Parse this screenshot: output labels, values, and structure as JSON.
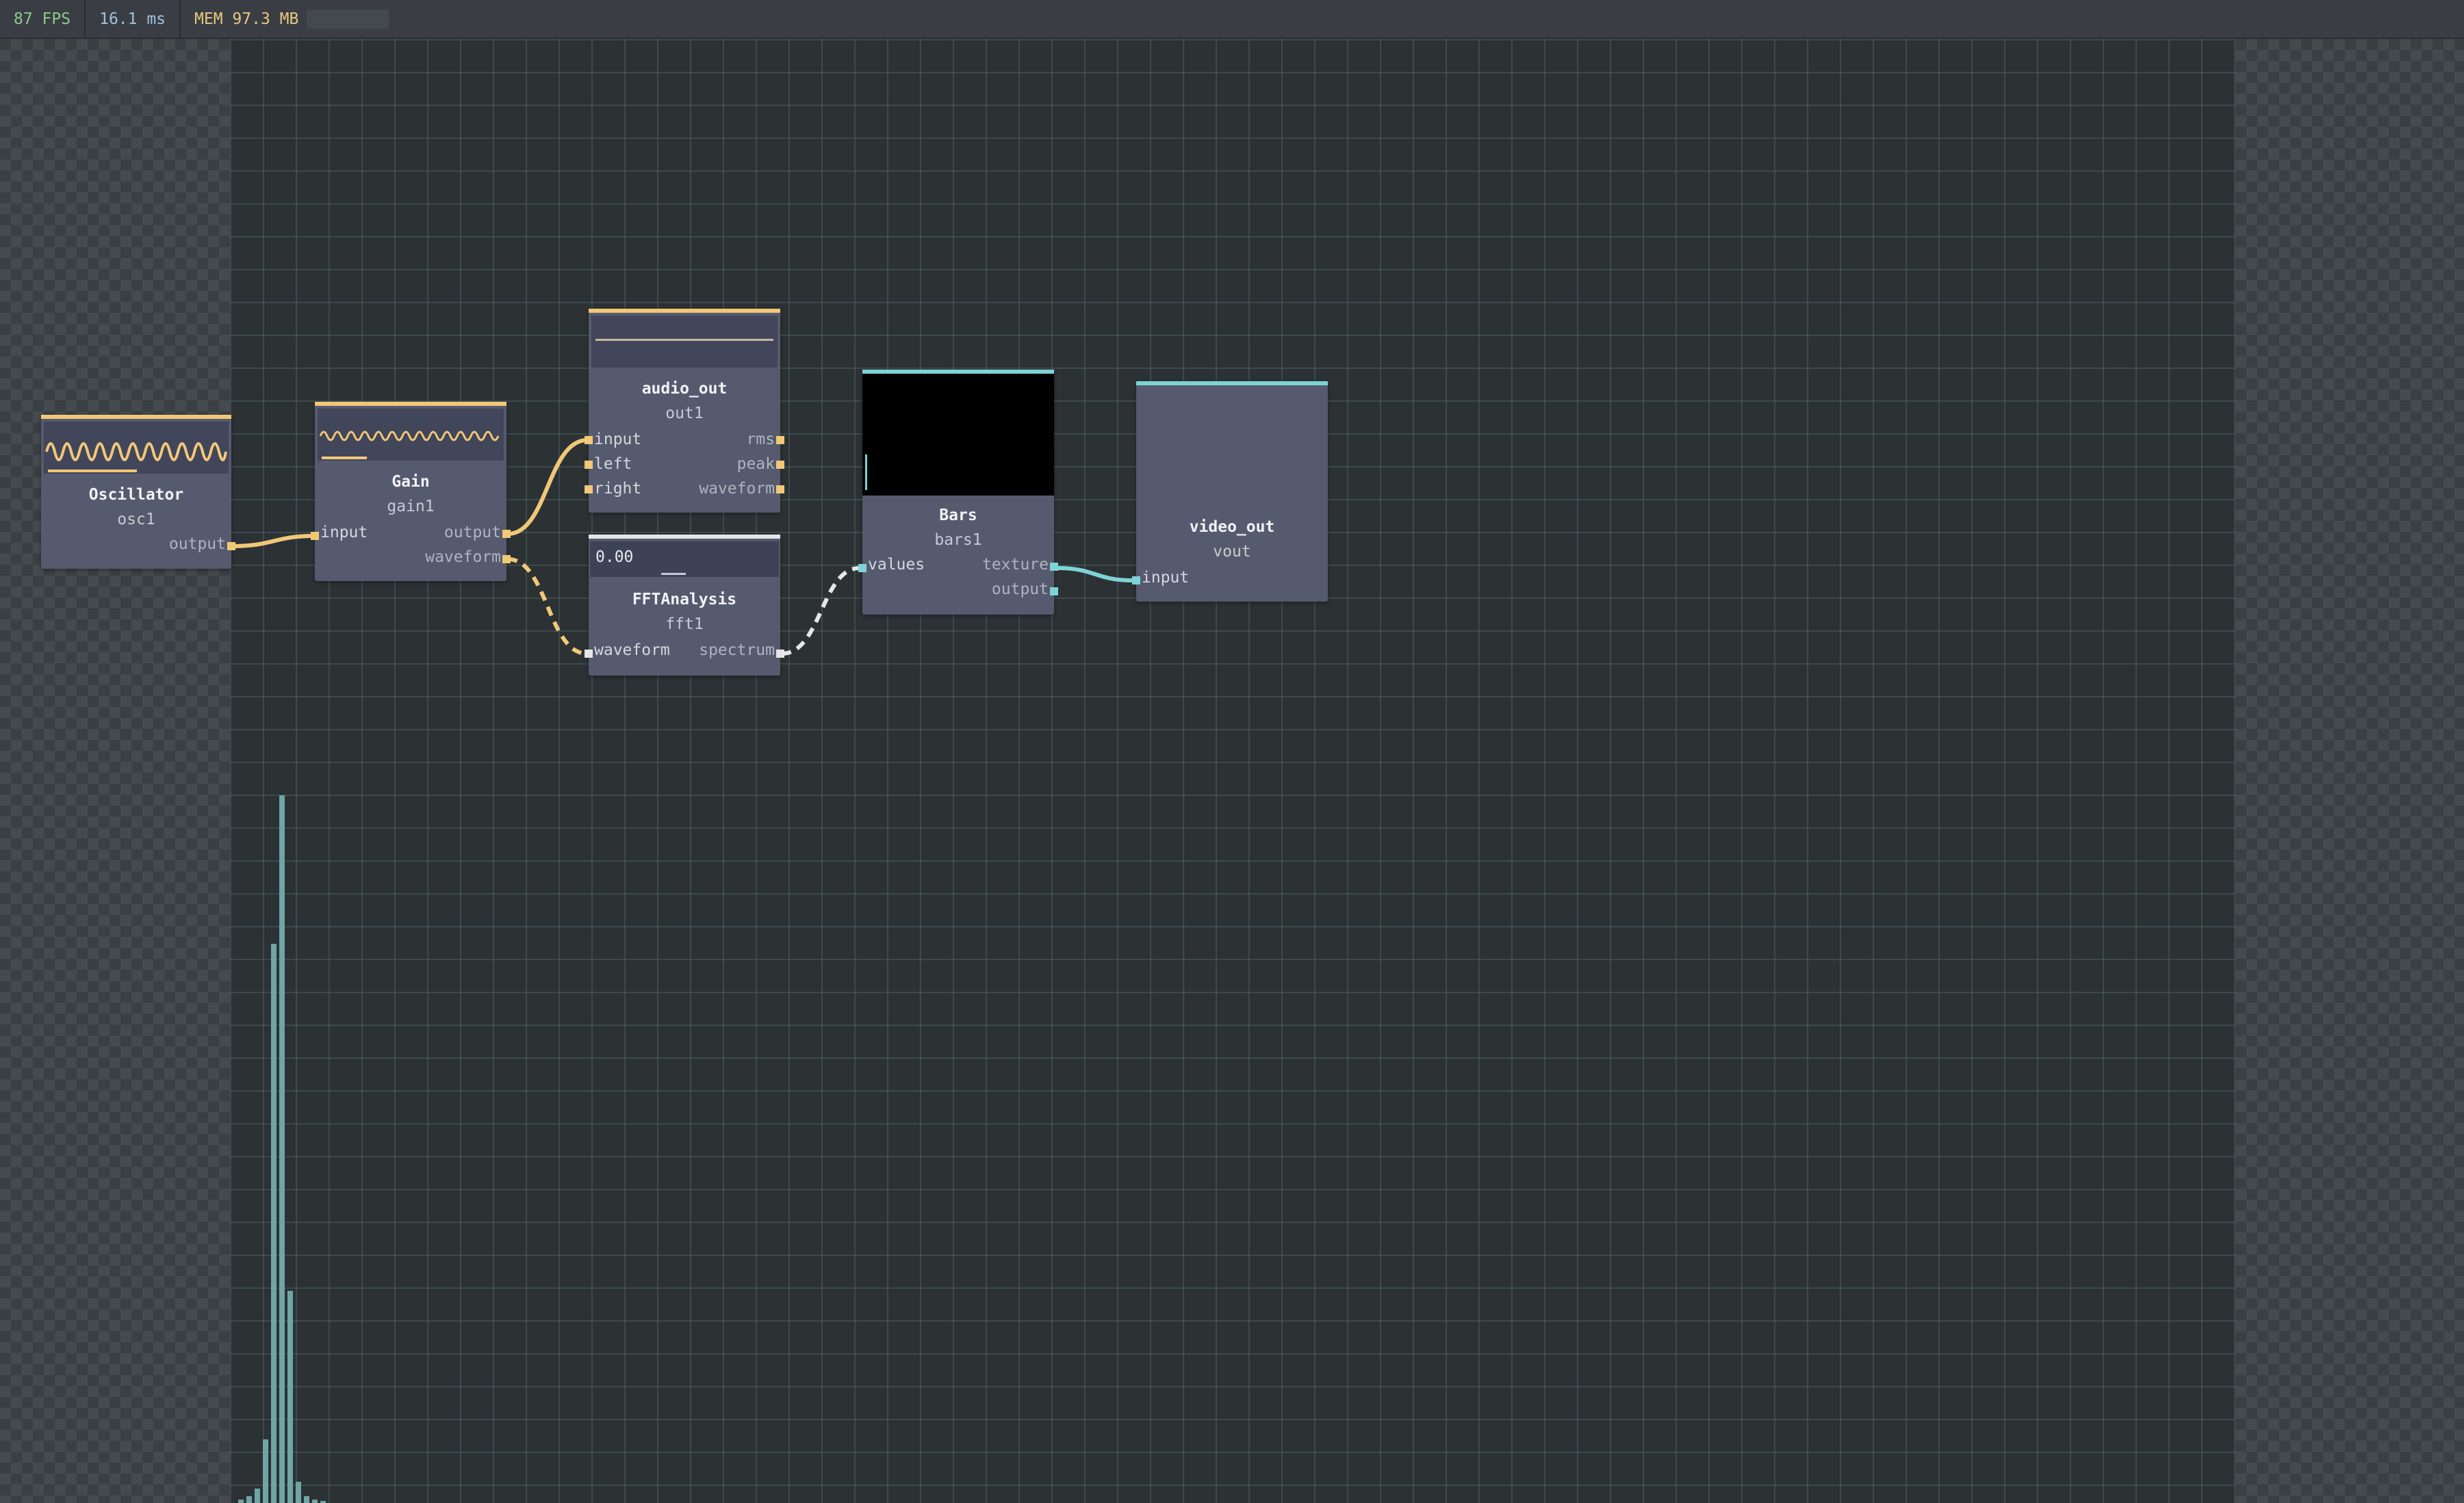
{
  "status": {
    "fps": "87 FPS",
    "frame_time": "16.1 ms",
    "memory": "MEM 97.3 MB"
  },
  "colors": {
    "audio": "#f0c878",
    "video": "#7dd3d6",
    "node_bg": "#555a6e",
    "canvas": "#2c3134"
  },
  "nodes": {
    "oscillator": {
      "title": "Oscillator",
      "id": "osc1",
      "outputs": [
        "output"
      ]
    },
    "gain": {
      "title": "Gain",
      "id": "gain1",
      "inputs": [
        "input"
      ],
      "outputs": [
        "output",
        "waveform"
      ]
    },
    "audio_out": {
      "title": "audio_out",
      "id": "out1",
      "inputs": [
        "input",
        "left",
        "right"
      ],
      "outputs": [
        "rms",
        "peak",
        "waveform"
      ]
    },
    "fft": {
      "title": "FFTAnalysis",
      "id": "fft1",
      "readout": "0.00",
      "inputs": [
        "waveform"
      ],
      "outputs": [
        "spectrum"
      ]
    },
    "bars": {
      "title": "Bars",
      "id": "bars1",
      "inputs": [
        "values"
      ],
      "outputs": [
        "texture",
        "output"
      ]
    },
    "video_out": {
      "title": "video_out",
      "id": "vout",
      "inputs": [
        "input"
      ]
    }
  },
  "spectrum_levels": [
    0.005,
    0.01,
    0.02,
    0.09,
    0.79,
    1.0,
    0.3,
    0.03,
    0.01,
    0.005,
    0.003
  ]
}
